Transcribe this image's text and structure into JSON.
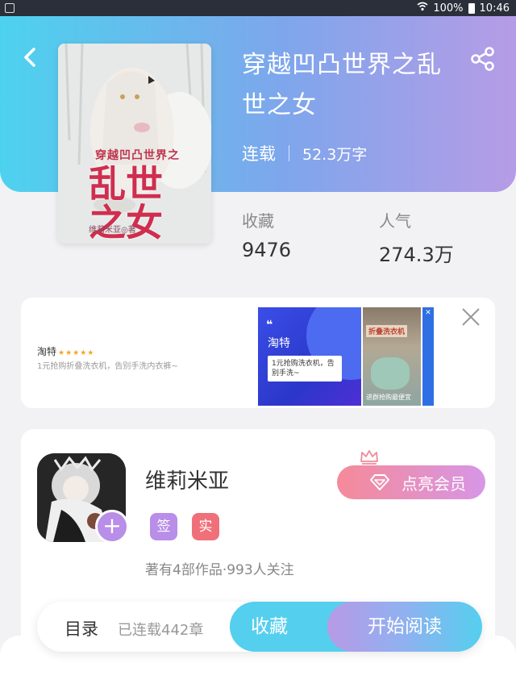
{
  "status_bar": {
    "battery": "100%",
    "time": "10:46"
  },
  "book": {
    "title": "穿越凹凸世界之乱世之女",
    "cover_title_small": "穿越凹凸世界之",
    "cover_title_big": "乱世之女",
    "cover_author": "维莉米亚◎著",
    "status": "连载",
    "word_count": "52.3万字",
    "favorites_label": "收藏",
    "favorites_value": "9476",
    "popularity_label": "人气",
    "popularity_value": "274.3万"
  },
  "ad": {
    "brand": "淘特",
    "stars": "★★★★★",
    "description": "1元抢购折叠洗衣机，告别手洗内衣裤~",
    "image_quote": "❝",
    "image_title": "淘特",
    "image_bubble": "1元抢购洗衣机，告别手洗~",
    "image2_tag": "折叠洗衣机",
    "image2_footer": "进群抢购最便宜",
    "image3_close": "✕"
  },
  "author": {
    "name": "维莉米亚",
    "badge_sign": "签",
    "badge_real": "实",
    "stats": "著有4部作品·993人关注",
    "vip_label": "点亮会员",
    "add_label": "+"
  },
  "bottom_bar": {
    "toc_label": "目录",
    "serial_info": "已连载442章",
    "favorite_label": "收藏",
    "read_label": "开始阅读"
  },
  "colors": {
    "header_gradient_start": "#4dd2ee",
    "header_gradient_end": "#b69ce6",
    "accent_cyan": "#55cfee",
    "accent_purple": "#b98ee8",
    "accent_pink": "#f0707a"
  }
}
